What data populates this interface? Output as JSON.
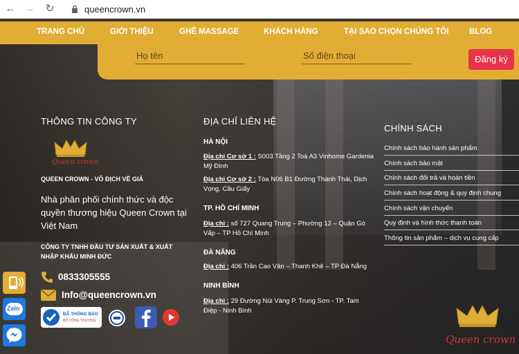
{
  "browser": {
    "url": "queencrown.vn"
  },
  "nav": {
    "items": [
      "TRANG CHỦ",
      "GIỚI THIỆU",
      "GHẾ MASSAGE",
      "KHÁCH HÀNG",
      "TẠI SAO CHỌN CHÚNG TÔI",
      "BLOG"
    ]
  },
  "register": {
    "name_placeholder": "Họ tên",
    "phone_placeholder": "Số điện thoại",
    "button": "Đăng ký"
  },
  "company": {
    "heading": "THÔNG TIN CÔNG TY",
    "logo_text": "Queen crown",
    "slogan": "QUEEN CROWN - VÔ ĐỊCH VỀ GIÁ",
    "description": "Nhà phân phối chính thức và độc quyền thương hiệu Queen Crown tại Việt Nam",
    "legal_name": "CÔNG TY TNHH ĐẦU TƯ SẢN XUẤT & XUẤT NHẬP KHẨU MINH ĐỨC",
    "phone": "0833305555",
    "email": "Info@queencrown.vn",
    "badge_text": "ĐÃ THÔNG BÁO",
    "badge_sub": "BỘ CÔNG THƯƠNG"
  },
  "contact": {
    "heading": "ĐỊA CHỈ LIÊN HỆ",
    "hanoi": {
      "city": "HÀ NỘI",
      "addr1_label": "Địa chỉ Cơ sở 1 :",
      "addr1": " S003 Tầng 2 Toà A3 Vinhome Gardenia Mỹ Đình",
      "addr2_label": "Địa chỉ Cơ sở 2 :",
      "addr2": " Tòa N06 B1 Đường Thành Thái, Dịch Vọng, Cầu Giấy"
    },
    "hcm": {
      "city": "TP. HỒ CHÍ MINH",
      "label": "Địa chỉ :",
      "addr": " số 727 Quang Trung – Phường 12 – Quận Gò Vấp – TP Hồ Chí Minh"
    },
    "danang": {
      "city": "ĐÀ NẴNG",
      "label": "Địa chỉ :",
      "addr": " 406 Trần Cao Vân – Thanh Khê – TP Đà Nẵng"
    },
    "ninhbinh": {
      "city": "NINH BÌNH",
      "label": "Địa chỉ :",
      "addr": " 29 Đường Núi Vàng P. Trung Sơn - TP. Tam Điệp - Ninh Bình"
    }
  },
  "policy": {
    "heading": "CHÍNH SÁCH",
    "links": [
      "Chính sách bảo hành sản phẩm",
      "Chính sách bảo mật",
      "Chính sách đổi trả và hoàn tiền",
      "Chính sách hoạt động & quy định chung",
      "Chính sách vận chuyển",
      "Quy định và hình thức thanh toán",
      "Thông tin sản phẩm – dịch vụ cung cấp"
    ]
  },
  "floating": {
    "zalo_label": "Zalo"
  },
  "corner_logo_text": "Queen crown",
  "colors": {
    "accent": "#e2ad35",
    "button": "#e8344a",
    "logo": "#c83a2a"
  }
}
